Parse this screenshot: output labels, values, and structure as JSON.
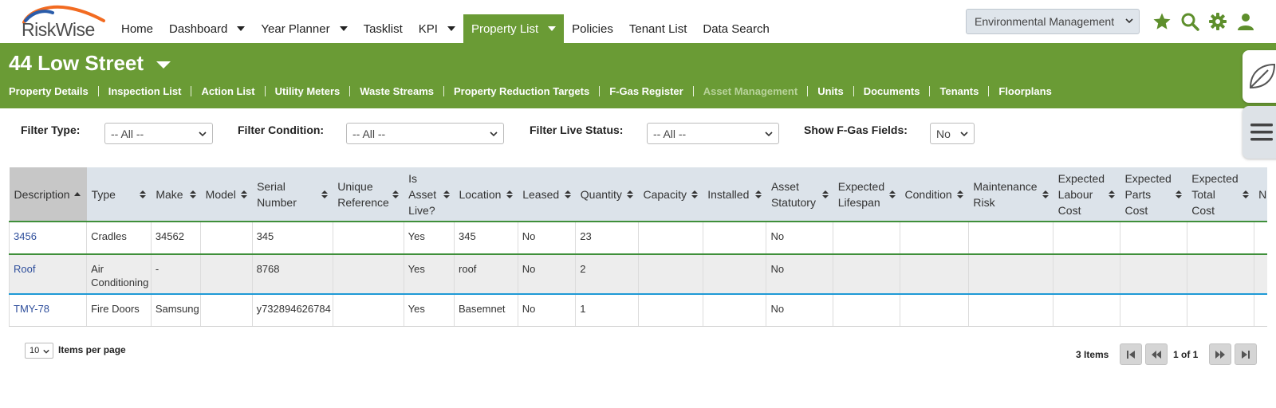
{
  "brand": {
    "name": "RiskWise"
  },
  "nav": {
    "items": [
      {
        "label": "Home",
        "has_menu": false,
        "active": false
      },
      {
        "label": "Dashboard",
        "has_menu": true,
        "active": false
      },
      {
        "label": "Year Planner",
        "has_menu": true,
        "active": false
      },
      {
        "label": "Tasklist",
        "has_menu": false,
        "active": false
      },
      {
        "label": "KPI",
        "has_menu": true,
        "active": false
      },
      {
        "label": "Property List",
        "has_menu": true,
        "active": true
      },
      {
        "label": "Policies",
        "has_menu": false,
        "active": false
      },
      {
        "label": "Tenant List",
        "has_menu": false,
        "active": false
      },
      {
        "label": "Data Search",
        "has_menu": false,
        "active": false
      }
    ],
    "module_select": "Environmental Management",
    "icons": [
      "star-icon",
      "search-icon",
      "gear-icon",
      "user-icon"
    ]
  },
  "property": {
    "title": "44 Low Street",
    "subnav": [
      {
        "label": "Property Details",
        "disabled": false
      },
      {
        "label": "Inspection List",
        "disabled": false
      },
      {
        "label": "Action List",
        "disabled": false
      },
      {
        "label": "Utility Meters",
        "disabled": false
      },
      {
        "label": "Waste Streams",
        "disabled": false
      },
      {
        "label": "Property Reduction Targets",
        "disabled": false
      },
      {
        "label": "F-Gas Register",
        "disabled": false
      },
      {
        "label": "Asset Management",
        "disabled": true
      },
      {
        "label": "Units",
        "disabled": false
      },
      {
        "label": "Documents",
        "disabled": false
      },
      {
        "label": "Tenants",
        "disabled": false
      },
      {
        "label": "Floorplans",
        "disabled": false
      }
    ]
  },
  "filters": {
    "type": {
      "label": "Filter Type:",
      "value": "-- All --"
    },
    "condition": {
      "label": "Filter Condition:",
      "value": "-- All --"
    },
    "live_status": {
      "label": "Filter Live Status:",
      "value": "-- All --"
    },
    "fgas": {
      "label": "Show F-Gas Fields:",
      "value": "No"
    }
  },
  "table": {
    "columns": [
      "Description",
      "Type",
      "Make",
      "Model",
      "Serial Number",
      "Unique Reference",
      "Is Asset Live?",
      "Location",
      "Leased",
      "Quantity",
      "Capacity",
      "Installed",
      "Asset Statutory",
      "Expected Lifespan",
      "Condition",
      "Maintenance Risk",
      "Expected Labour Cost",
      "Expected Parts Cost",
      "Expected Total Cost",
      "N"
    ],
    "rows": [
      [
        "3456",
        "Cradles",
        "34562",
        "",
        "345",
        "",
        "Yes",
        "345",
        "No",
        "23",
        "",
        "",
        "No",
        "",
        "",
        "",
        "",
        "",
        "",
        ""
      ],
      [
        "Roof",
        "Air Conditioning",
        "-",
        "",
        "8768",
        "",
        "Yes",
        "roof",
        "No",
        "2",
        "",
        "",
        "No",
        "",
        "",
        "",
        "",
        "",
        "",
        ""
      ],
      [
        "TMY-78",
        "Fire Doors",
        "Samsung",
        "",
        "y732894626784",
        "",
        "Yes",
        "Basemnet",
        "No",
        "1",
        "",
        "",
        "No",
        "",
        "",
        "",
        "",
        "",
        "",
        ""
      ]
    ]
  },
  "pager": {
    "items_per_page": "10",
    "items_per_page_label": "Items per page",
    "count": "3 Items",
    "page_info": "1 of 1"
  },
  "colors": {
    "brand_green": "#6a9b35",
    "header_grey": "#dce3ea",
    "link": "#2f4f9c"
  }
}
